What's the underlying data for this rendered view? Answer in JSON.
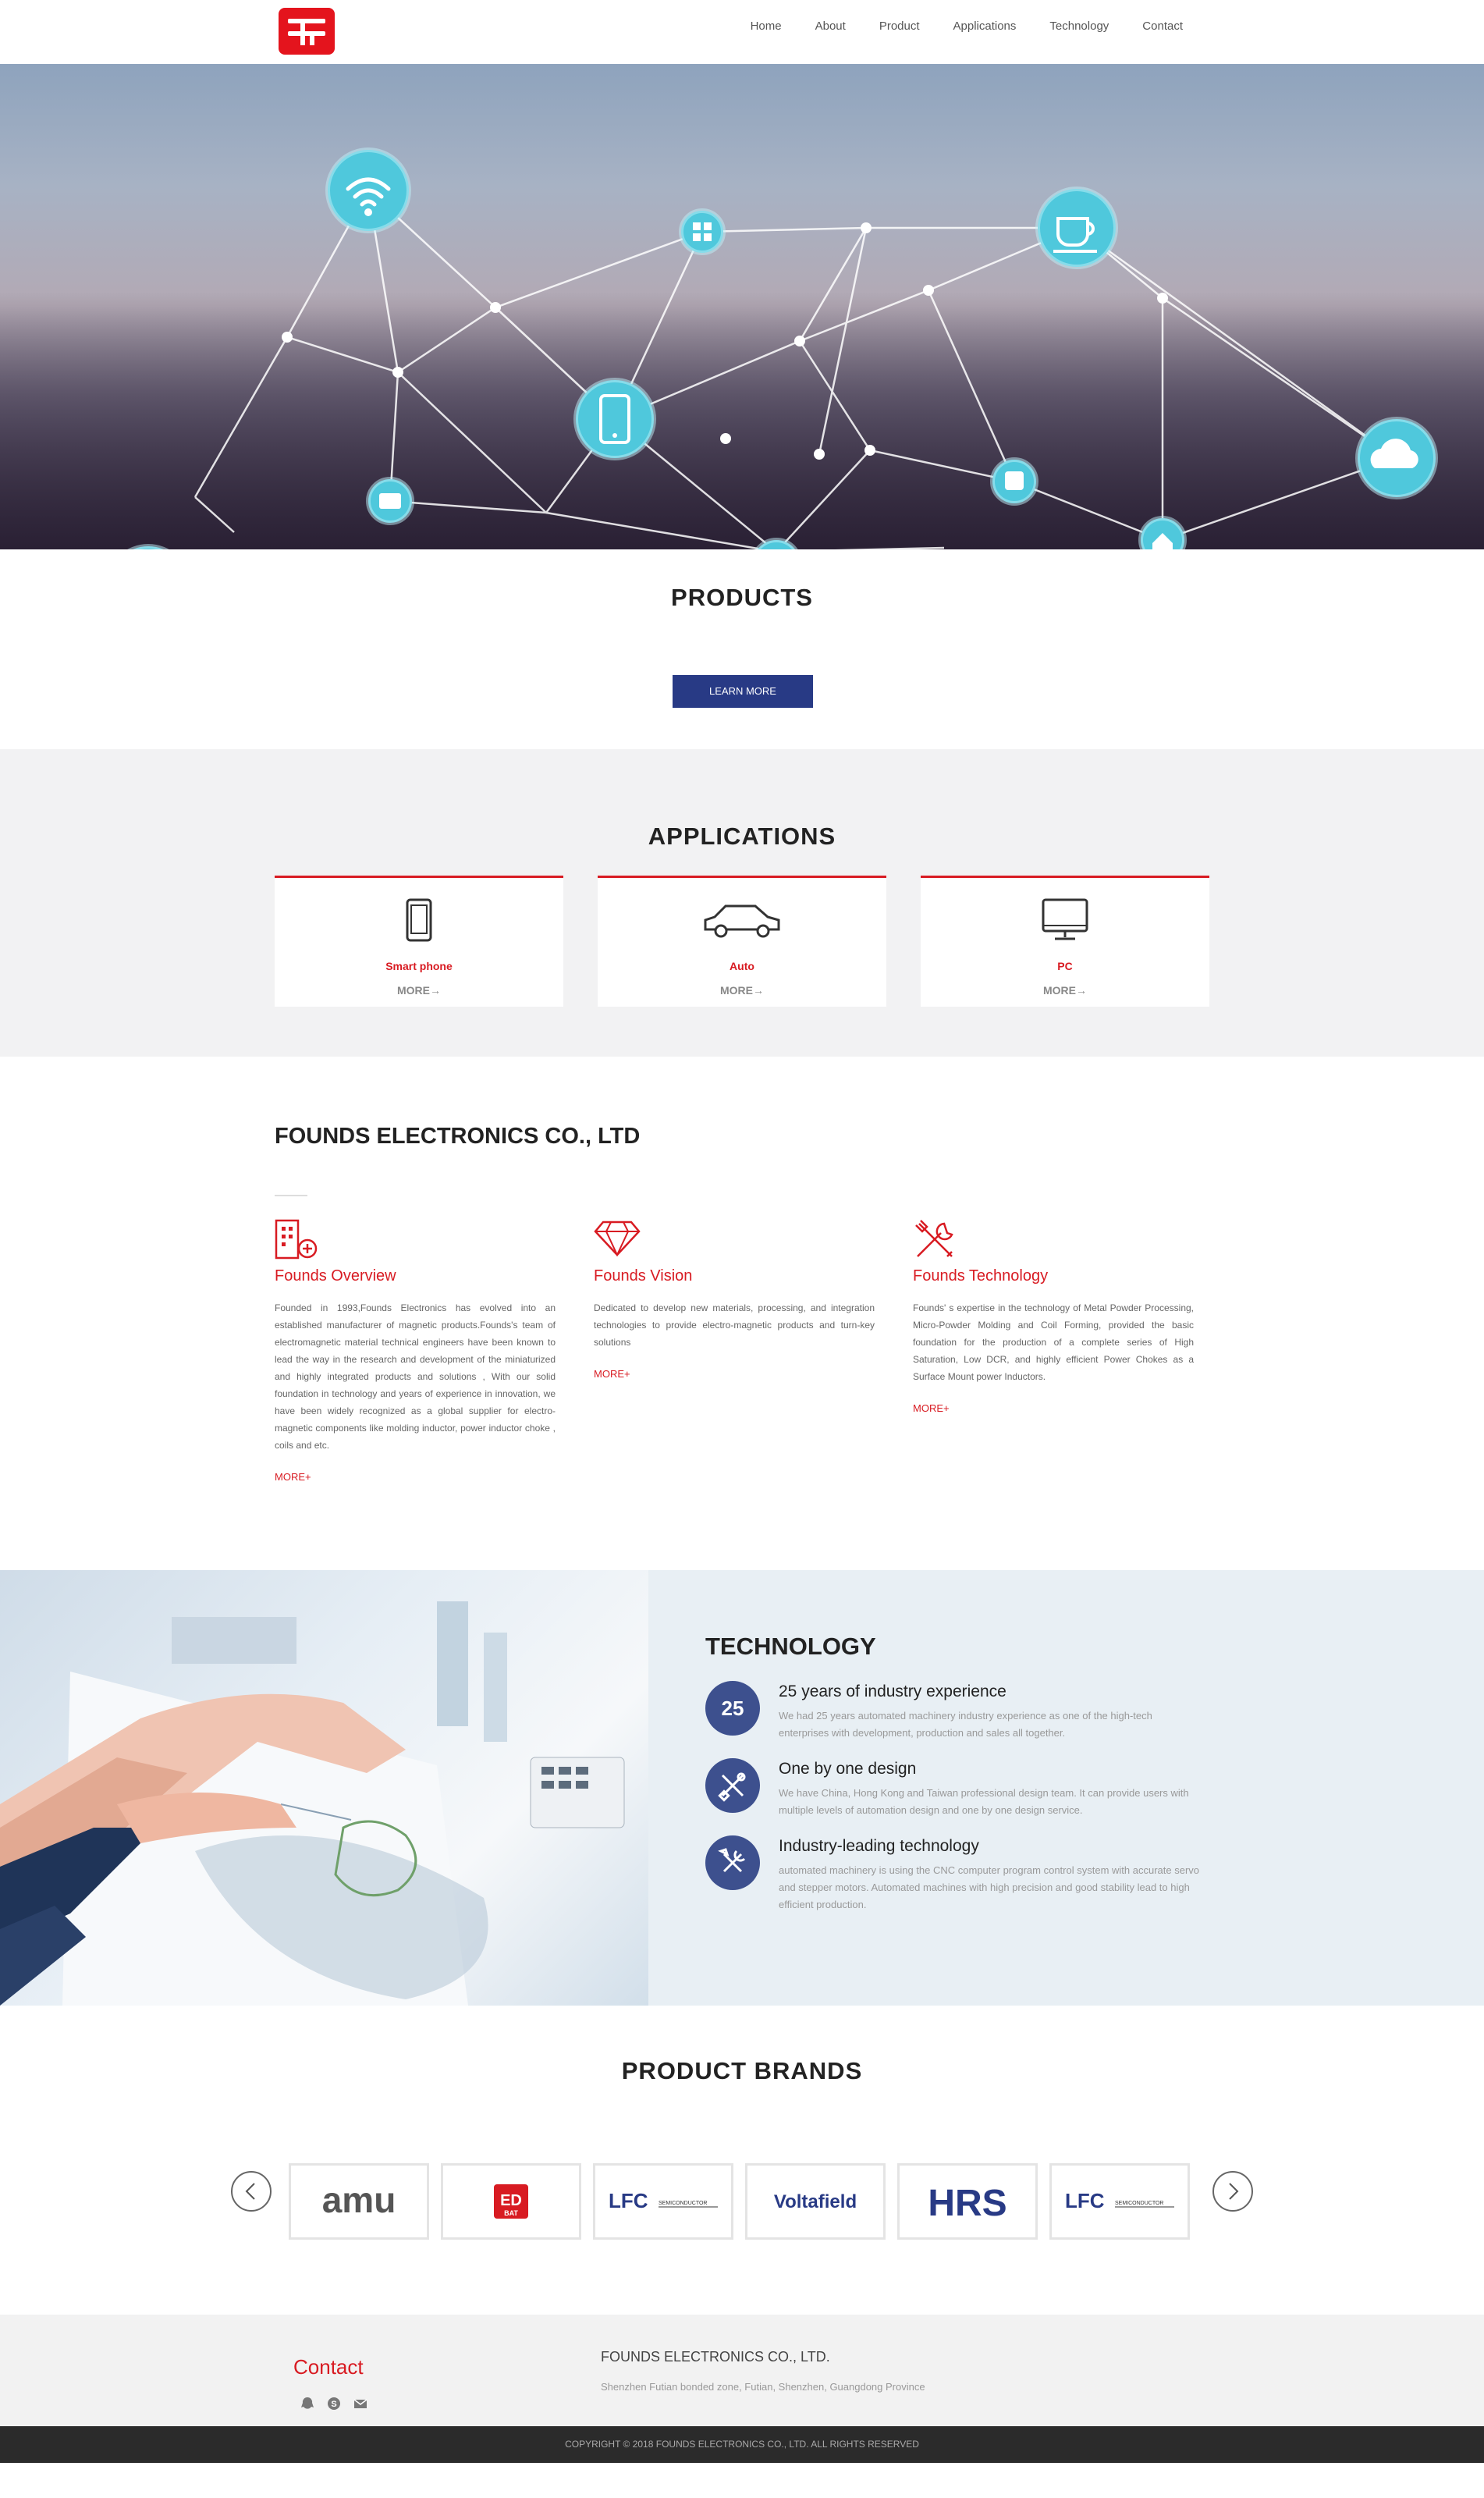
{
  "header": {
    "nav": [
      "Home",
      "About",
      "Product",
      "Applications",
      "Technology",
      "Contact"
    ]
  },
  "banner": {
    "slides": 3,
    "active_slide": 1
  },
  "products": {
    "title": "PRODUCTS",
    "button": "LEARN MORE"
  },
  "applications": {
    "title": "APPLICATIONS",
    "items": [
      {
        "name": "Smart phone",
        "more": "MORE→",
        "icon": "smartphone-icon"
      },
      {
        "name": "Auto",
        "more": "MORE→",
        "icon": "car-icon"
      },
      {
        "name": "PC",
        "more": "MORE→",
        "icon": "monitor-icon"
      }
    ]
  },
  "company": {
    "title": "FOUNDS ELECTRONICS CO., LTD",
    "columns": [
      {
        "title": "Founds Overview",
        "icon": "building-icon",
        "text": "Founded in 1993,Founds Electronics has evolved into an established manufacturer of magnetic products.Founds's team of electromagnetic material technical engineers have been known to lead the way in the research and development of the miniaturized and highly integrated products and solutions , With our solid foundation in technology and years of experience in innovation, we have been widely recognized as a global supplier for electro-magnetic components like molding inductor, power inductor choke , coils and etc.",
        "more": "MORE+"
      },
      {
        "title": "Founds Vision",
        "icon": "diamond-icon",
        "text": "Dedicated to develop new materials, processing, and integration technologies to provide electro-magnetic products and turn-key solutions",
        "more": "MORE+"
      },
      {
        "title": "Founds Technology",
        "icon": "tools-icon",
        "text": "Founds' s expertise in the technology of Metal Powder Processing, Micro-Powder Molding and Coil Forming, provided the basic foundation for the production of a complete series of High Saturation, Low DCR, and highly efficient Power Chokes as a Surface Mount power Inductors.",
        "more": "MORE+"
      }
    ]
  },
  "technology": {
    "title": "TECHNOLOGY",
    "items": [
      {
        "badge": "25",
        "title": "25 years of industry experience",
        "text": "We had 25 years automated machinery industry experience as one of the high-tech enterprises with development, production and sales all together."
      },
      {
        "badge": "",
        "icon": "design-tools-icon",
        "title": "One by one design",
        "text": "We have China, Hong Kong and Taiwan professional design team. It can provide users with multiple levels of automation design and one by one design service."
      },
      {
        "badge": "",
        "icon": "wrench-screwdriver-icon",
        "title": "Industry-leading technology",
        "text": "automated machinery is using the CNC computer program control system with accurate servo and stepper motors. Automated machines with high precision and good stability lead to high efficient production."
      }
    ]
  },
  "brands": {
    "title": "PRODUCT BRANDS",
    "logos": [
      "amu",
      "ED",
      "LFC",
      "Voltafield",
      "HRS",
      "LFC"
    ],
    "ed_sub": "BAT",
    "lfc_sub": "SEMICONDUCTOR"
  },
  "footer": {
    "contact": "Contact",
    "company": "FOUNDS ELECTRONICS CO., LTD.",
    "address": "Shenzhen Futian bonded zone, Futian, Shenzhen, Guangdong Province",
    "copyright": "COPYRIGHT © 2018 FOUNDS ELECTRONICS CO., LTD. ALL RIGHTS RESERVED"
  },
  "colors": {
    "brand_red": "#d81b22",
    "navy": "#283a85",
    "tech_circle": "#3d508e",
    "node_cyan": "#4fc8dc"
  }
}
